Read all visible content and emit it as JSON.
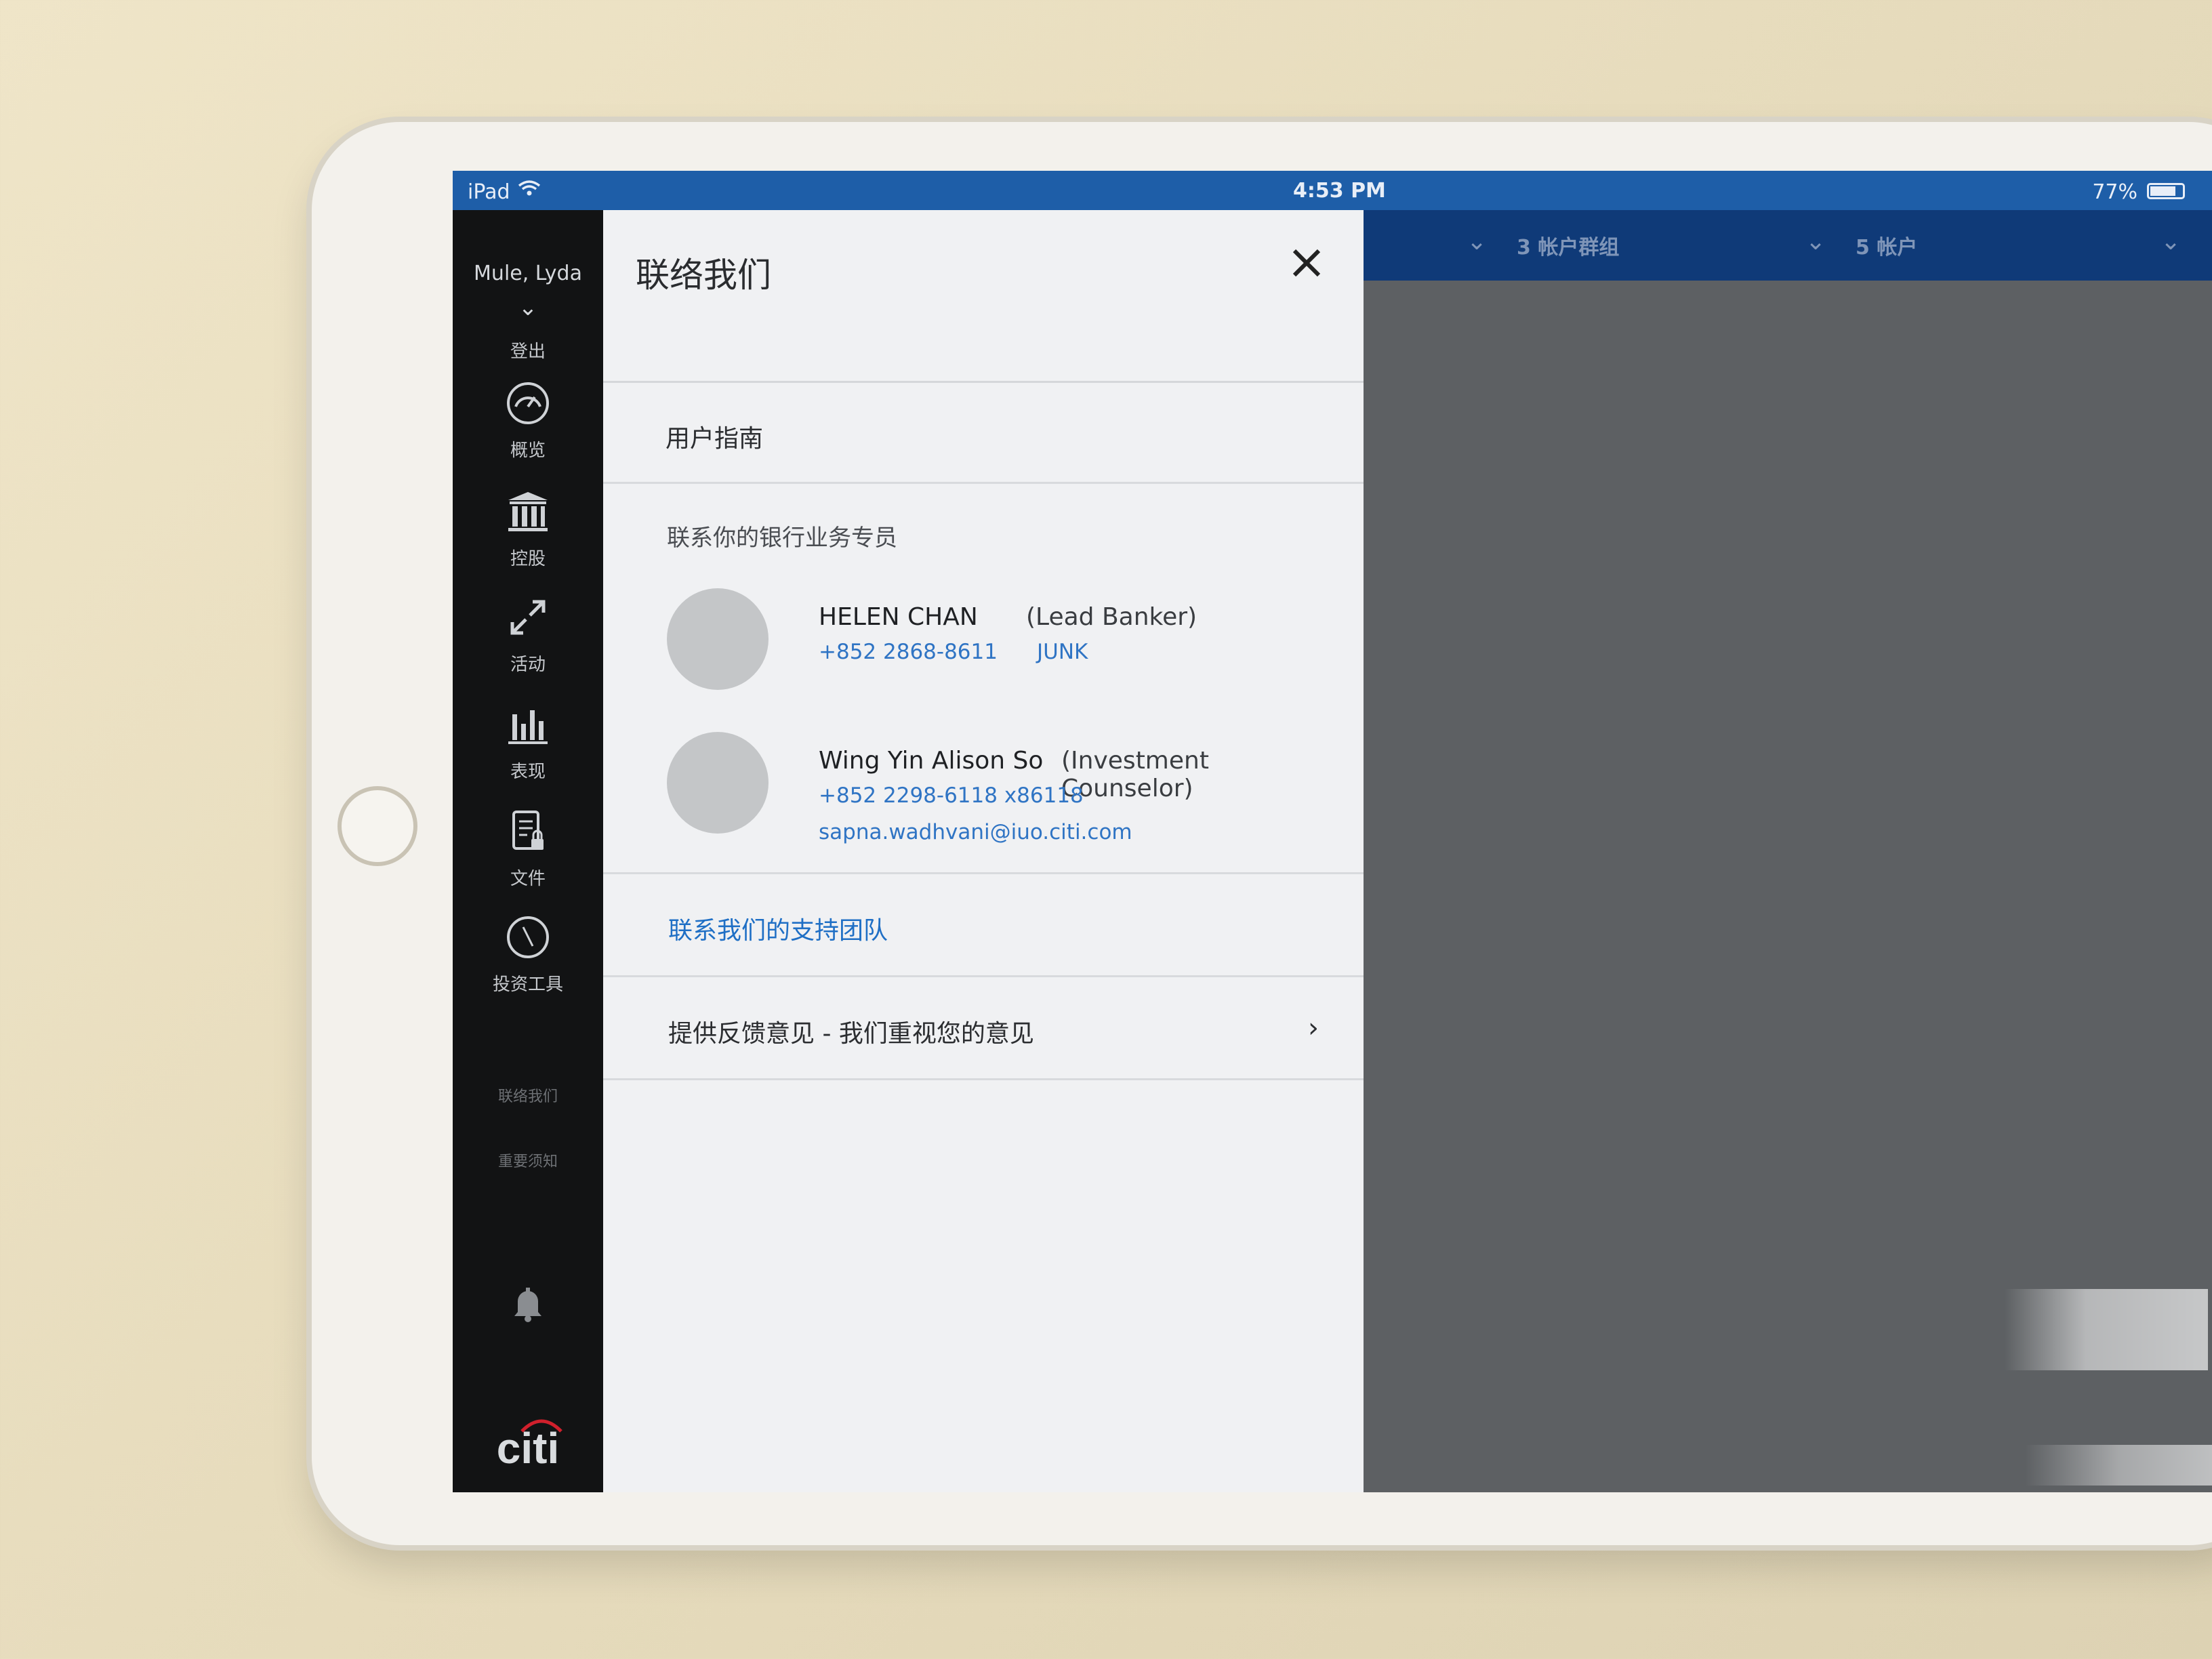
{
  "status_bar": {
    "device": "iPad",
    "time": "4:53 PM",
    "battery": "77%",
    "battery_level": 0.77
  },
  "header": {
    "account_groups": "3 帐户群组",
    "accounts": "5 帐户"
  },
  "sidebar": {
    "user_name": "Mule, Lyda",
    "logout": "登出",
    "items": [
      {
        "label": "概览",
        "icon": "gauge-icon"
      },
      {
        "label": "控股",
        "icon": "bank-icon"
      },
      {
        "label": "活动",
        "icon": "transfer-arrows-icon"
      },
      {
        "label": "表现",
        "icon": "bar-chart-icon"
      },
      {
        "label": "文件",
        "icon": "document-lock-icon"
      },
      {
        "label": "投资工具",
        "icon": "compass-icon"
      }
    ],
    "contact_us": "联络我们",
    "important_notice": "重要须知",
    "bell_icon": "bell-icon",
    "logo": "citi"
  },
  "drawer": {
    "title": "联络我们",
    "close_icon": "close-icon",
    "user_guide": "用户指南",
    "banker_section_title": "联系你的银行业务专员",
    "contacts": [
      {
        "name": "HELEN CHAN",
        "role": "(Lead Banker)",
        "phone": "+852 2868-8611",
        "extra": "JUNK"
      },
      {
        "name": "Wing Yin Alison So",
        "role": "(Investment Counselor)",
        "phone": "+852 2298-6118 x86118",
        "email": "sapna.wadhvani@iuo.citi.com"
      }
    ],
    "support_link": "联系我们的支持团队",
    "feedback": "提供反馈意见 - 我们重视您的意见"
  }
}
